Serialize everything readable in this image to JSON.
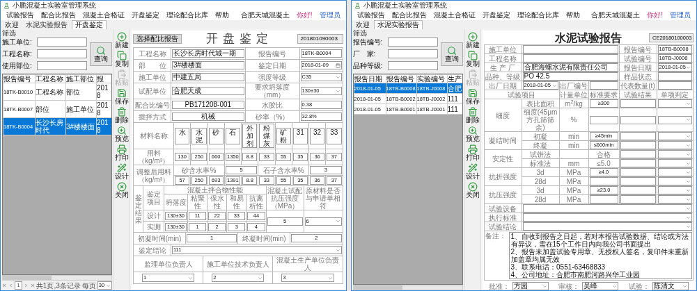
{
  "windows": [
    {
      "title": "小鹏混凝土实验室管理系统",
      "menu": [
        "试验报告",
        "配合比报告",
        "混凝土合格证",
        "开盘鉴定",
        "理论配合比库",
        "帮助"
      ],
      "user": {
        "company": "合肥天城混凝土",
        "greeting": "你好!",
        "role": "管理员"
      },
      "tabs": [
        {
          "label": "欢迎",
          "selected": false
        },
        {
          "label": "水泥实验报告",
          "selected": false
        },
        {
          "label": "开盘鉴定",
          "selected": true
        }
      ],
      "filter": {
        "group": "筛选",
        "fields": [
          "施工单位:",
          "工程名称:",
          "使用部位:"
        ],
        "button": "查询"
      },
      "list": {
        "columns": [
          "报告编号",
          "工程名称",
          "施工部位",
          "报"
        ],
        "rows": [
          {
            "cells": [
              "18TK-B0010",
              "工程名称",
              "部位",
              "2018"
            ],
            "selected": false
          },
          {
            "cells": [
              "18TK-B0007",
              "部位",
              "施工单位",
              "2018"
            ],
            "selected": false
          },
          {
            "cells": [
              "18TK-B0004",
              "长沙长房时代",
              "3#楼楼面",
              "2018"
            ],
            "selected": true
          }
        ]
      },
      "pager": {
        "page": "1",
        "summary": "共1页,3条记录",
        "per_page_label": "每页",
        "per_page": "30"
      },
      "toolbar": [
        {
          "label": "新建",
          "disabled": false
        },
        {
          "label": "复制",
          "disabled": false
        },
        {
          "label": "粘贴",
          "disabled": true
        },
        {
          "label": "保存",
          "disabled": false
        },
        {
          "label": "删除",
          "disabled": false
        },
        {
          "label": "预览",
          "disabled": false
        },
        {
          "label": "打印",
          "disabled": false
        },
        {
          "label": "设计",
          "disabled": false
        },
        {
          "label": "关闭",
          "disabled": false
        }
      ],
      "form": {
        "kind": "mix_check",
        "select_button": "选择配比报告",
        "title": "开盘鉴定",
        "number": "201801090003",
        "top": [
          {
            "label": "工程名称",
            "value": "长沙长房时代城一期",
            "side": {
              "label": "报告编号",
              "value": "18TK-B0004",
              "kind": "text"
            }
          },
          {
            "label": "部　　位",
            "value": "3#楼楼面",
            "side": {
              "label": "鉴定日期",
              "value": "2018-01-09",
              "kind": "date"
            }
          }
        ],
        "mid": [
          {
            "label": "施工单位",
            "value": "中建五局",
            "centered": false,
            "side": {
              "label": "强度等级",
              "value": "C35",
              "kind": "select"
            }
          },
          {
            "label": "试配单位",
            "value": "合肥天成",
            "centered": false,
            "side": {
              "label": "要求坍落度（mm）",
              "value": "130±30",
              "kind": "select"
            }
          },
          {
            "label": "配合比编号",
            "value": "PB171208-001",
            "centered": true,
            "side": {
              "label": "水胶比",
              "value": "0.38",
              "kind": "text"
            }
          },
          {
            "label": "搅拌方式",
            "value": "机械",
            "centered": true,
            "side": {
              "label": "砂率（%）",
              "value": "32.8%",
              "kind": "text"
            }
          }
        ],
        "materials": {
          "name_label": "材料名称",
          "names": [
            "水",
            "水泥",
            "砂",
            "石",
            "外加剂",
            "粉煤灰",
            "矿粉",
            "31",
            "32",
            "33"
          ],
          "amount_label": "用料（kg/m³）",
          "amounts": [
            "130",
            "250",
            "660",
            "1350",
            "8.8",
            "33",
            "55",
            "35",
            "36",
            "37"
          ]
        },
        "adjusted": {
          "label": "调整后用料（kg/m³）",
          "sand_label": "砂含水率%",
          "sand": "5",
          "stone_label": "石子含水率%",
          "stone": "3",
          "amounts": [
            "57",
            "250",
            "693",
            "1391",
            "8.8",
            "33",
            "55",
            "35",
            "36",
            "37"
          ]
        },
        "result": {
          "label": "鉴定结果",
          "item_label": "鉴定项目",
          "group_label": "混凝土拌合物性能",
          "columns": [
            "坍落度",
            "粘聚性",
            "保水性",
            "和易性",
            "抗离析性"
          ],
          "strength_label": "混凝土试配抗压强度（MPa）",
          "match_label": "原材料是否与申请单相符",
          "rows": [
            {
              "label": "设计",
              "values": [
                "130±30",
                "11",
                "22",
                "33",
                "44"
              ]
            },
            {
              "label": "实测",
              "values": [
                "130±30",
                "1",
                "2",
                "3",
                "4"
              ]
            }
          ],
          "strength": "5",
          "match": "6"
        },
        "set_time": {
          "initial_label": "初凝时间(min)",
          "initial": "1",
          "final_label": "终凝时间(min)",
          "final": "2"
        },
        "conclusion": {
          "label": "鉴定结论",
          "value": "111"
        },
        "signers": [
          {
            "label": "监理单位负责人",
            "value": "1"
          },
          {
            "label": "施工单位技术负责人",
            "value": "2"
          },
          {
            "label": "混凝土生产单位负责人",
            "value": "3"
          }
        ]
      }
    },
    {
      "title": "小鹏混凝土实验室管理系统",
      "menu": [
        "试验报告",
        "配合比报告",
        "混凝土合格证",
        "开盘鉴定",
        "理论配合比库",
        "帮助"
      ],
      "user": {
        "company": "合肥天城混凝土",
        "greeting": "你好!",
        "role": "管理员"
      },
      "tabs": [
        {
          "label": "欢迎",
          "selected": false
        },
        {
          "label": "水泥实验报告",
          "selected": true
        }
      ],
      "filter": {
        "group": "筛选",
        "fields": [
          "报告编号:",
          "厂　家:",
          "品种等级:"
        ],
        "button": "查询"
      },
      "list": {
        "columns": [
          "报告日期",
          "报告编号",
          "实验编号",
          "生产"
        ],
        "rows": [
          {
            "cells": [
              "2018-01-05",
              "18TB-B0008",
              "18TB-J0008",
              "合肥"
            ],
            "selected": true
          },
          {
            "cells": [
              "2018-01-05",
              "18TB-B0002",
              "18TB-J0002",
              "111"
            ],
            "selected": false
          },
          {
            "cells": [
              "2018-01-05",
              "18TB-B0001",
              "18TB-J0001",
              "111"
            ],
            "selected": false
          }
        ]
      },
      "toolbar": [
        {
          "label": "新建",
          "disabled": false
        },
        {
          "label": "复制",
          "disabled": false
        },
        {
          "label": "粘贴",
          "disabled": true
        },
        {
          "label": "保存",
          "disabled": false
        },
        {
          "label": "删除",
          "disabled": false
        },
        {
          "label": "预览",
          "disabled": false
        },
        {
          "label": "打印",
          "disabled": false
        },
        {
          "label": "设计",
          "disabled": false
        },
        {
          "label": "关闭",
          "disabled": false
        }
      ],
      "form": {
        "kind": "cement_report",
        "title": "水泥试验报告",
        "number": "CE20180100003",
        "info": [
          {
            "label": "施工单位",
            "side": {
              "label": "报告编号",
              "value": "18TB-B0008",
              "kind": "text"
            }
          },
          {
            "label": "工程名称",
            "side": {
              "label": "试验编号",
              "value": "18TB-J0008",
              "kind": "text"
            }
          },
          {
            "label": "生 产 厂",
            "value": "合肥海螺水泥有限责任公司",
            "side": {
              "label": "报告日期",
              "value": "2018-01-05",
              "kind": "select"
            }
          },
          {
            "label": "品种、等级",
            "value": "PO 42.5",
            "side": {
              "label": "样品状态",
              "kind": "text"
            }
          }
        ],
        "delivery": {
          "date_label": "出厂日期",
          "date": "2018-01-05",
          "number_label": "出厂编号",
          "amount_label": "代表数量(t)"
        },
        "header": [
          "试验项目",
          "计量单位",
          "标准要求",
          "试验结果",
          "单项判定"
        ],
        "groups": [
          {
            "label": "细度",
            "rows": [
              {
                "item": "表比面积",
                "unit": "m$^{2}$/kg",
                "standard": "≥300",
                "kind": "input"
              },
              {
                "item": "细度(45μm方孔筛筛余)",
                "unit": "%",
                "kind": "input"
              }
            ]
          },
          {
            "label": "凝结时间",
            "rows": [
              {
                "item": "初凝",
                "unit": "min",
                "standard": "≥45min",
                "kind": "input"
              },
              {
                "item": "终凝",
                "unit": "min",
                "standard": "≤600min",
                "kind": "input"
              }
            ]
          },
          {
            "label": "安定性",
            "rows": [
              {
                "item": "试饼法",
                "standard": "合格",
                "kind": "text"
              },
              {
                "item": "标准法",
                "unit": "mm",
                "standard": "≤5.0",
                "kind": "text"
              }
            ]
          },
          {
            "label": "抗折强度",
            "rows": [
              {
                "item": "3d",
                "unit": "MPa",
                "standard": "≥4.0",
                "kind": "input"
              },
              {
                "item": "28d",
                "unit": "MPa",
                "kind": "input"
              }
            ]
          },
          {
            "label": "抗压强度",
            "rows": [
              {
                "item": "3d",
                "unit": "MPa",
                "standard": "≥23.0",
                "kind": "input"
              },
              {
                "item": "28d",
                "unit": "MPa",
                "kind": "input"
              }
            ]
          }
        ],
        "selects": [
          "试验设备",
          "执行标准",
          "试验结论"
        ],
        "remark": {
          "label": "备注：",
          "lines": [
            "1、自收到报告之日起，若对本报告试验数据、结论或方法有异议，需在15个工作日内向我公司书面提出",
            "2、报告未加盖试验专用章、无授权人签名，复印件未重新加盖章均属无效",
            "3、联系电话：0551-63468833",
            "4、公司地址：合肥市南肥河路兴华工业园"
          ]
        },
        "signers": [
          {
            "label": "批准：",
            "value": "方园"
          },
          {
            "label": "审核：",
            "value": "吴峰"
          },
          {
            "label": "试验：",
            "value": "陈清文"
          }
        ]
      }
    }
  ]
}
